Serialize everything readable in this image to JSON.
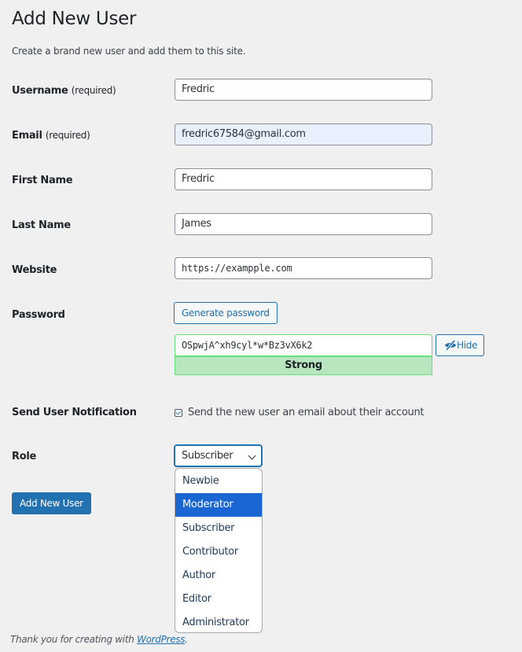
{
  "header": {
    "title": "Add New User",
    "description": "Create a brand new user and add them to this site."
  },
  "form": {
    "username": {
      "label": "Username",
      "required_label": "(required)",
      "value": "Fredric"
    },
    "email": {
      "label": "Email",
      "required_label": "(required)",
      "value": "fredric67584@gmail.com"
    },
    "first_name": {
      "label": "First Name",
      "value": "Fredric"
    },
    "last_name": {
      "label": "Last Name",
      "value": "James"
    },
    "website": {
      "label": "Website",
      "value": "https://exampple.com"
    },
    "password": {
      "label": "Password",
      "generate_label": "Generate password",
      "value": "OSpwjA^xh9cyl*w*Bz3vX6k2",
      "hide_label": "Hide",
      "strength": "Strong",
      "strength_color": "#b8e6bf"
    },
    "notification": {
      "label": "Send User Notification",
      "checkbox_label": "Send the new user an email about their account",
      "checked": true
    },
    "role": {
      "label": "Role",
      "selected": "Subscriber",
      "options": [
        "Newbie",
        "Moderator",
        "Subscriber",
        "Contributor",
        "Author",
        "Editor",
        "Administrator"
      ],
      "highlighted": "Moderator"
    },
    "submit_label": "Add New User"
  },
  "footer": {
    "text_prefix": "Thank you for creating with ",
    "link_text": "WordPress",
    "text_suffix": "."
  },
  "colors": {
    "accent": "#2271b1",
    "highlight": "#1a66d2",
    "background": "#f0f0f1"
  }
}
